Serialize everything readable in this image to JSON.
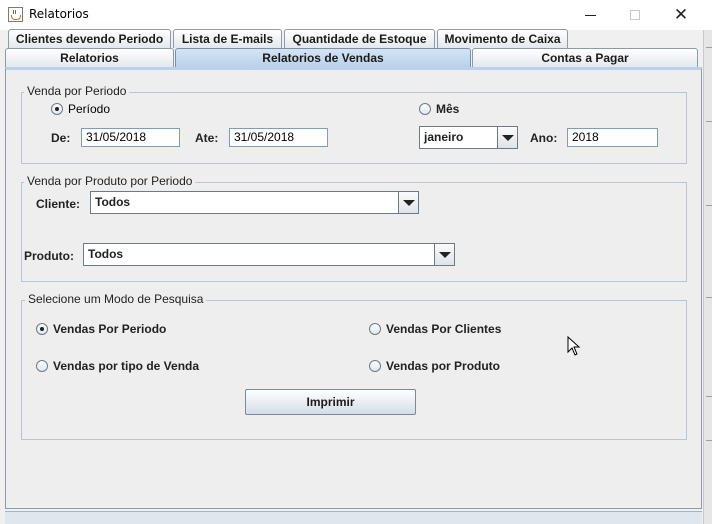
{
  "window": {
    "title": "Relatorios"
  },
  "tabs_row1": [
    "Clientes devendo Periodo",
    "Lista de E-mails",
    "Quantidade de Estoque",
    "Movimento de Caixa"
  ],
  "tabs_row2": [
    "Relatorios",
    "Relatorios de Vendas",
    "Contas a Pagar"
  ],
  "selected_tab": "Relatorios de Vendas",
  "venda_periodo": {
    "title": "Venda por Periodo",
    "radio_periodo": "Período",
    "radio_mes": "Mês",
    "de_label": "De:",
    "de_value": "31/05/2018",
    "ate_label": "Ate:",
    "ate_value": "31/05/2018",
    "mes_value": "janeiro",
    "ano_label": "Ano:",
    "ano_value": "2018"
  },
  "venda_produto": {
    "title": "Venda por Produto por Periodo",
    "cliente_label": "Cliente:",
    "cliente_value": "Todos",
    "produto_label": "Produto:",
    "produto_value": "Todos"
  },
  "modo_pesquisa": {
    "title": "Selecione um Modo de Pesquisa",
    "opt_periodo": "Vendas Por Periodo",
    "opt_clientes": "Vendas Por Clientes",
    "opt_tipo": "Vendas por tipo de Venda",
    "opt_produto": "Vendas por Produto",
    "print_label": "Imprimir"
  },
  "colors": {
    "selected_tab": "#b9d1ea",
    "tab_border": "#8e9aa8",
    "panel_bg": "#eeeeee"
  }
}
